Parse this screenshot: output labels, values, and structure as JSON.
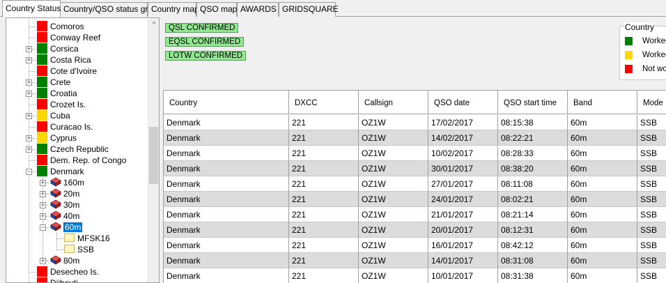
{
  "tabs": [
    {
      "label": "Country Status",
      "active": true
    },
    {
      "label": "Country/QSO status grid",
      "active": false
    },
    {
      "label": "Country map",
      "active": false
    },
    {
      "label": "QSO map",
      "active": false
    },
    {
      "label": "AWARDS",
      "active": false
    },
    {
      "label": "GRIDSQUARE",
      "active": false
    }
  ],
  "tree": {
    "items": [
      {
        "label": "Comoros",
        "status": "red",
        "expandable": false
      },
      {
        "label": "Conway Reef",
        "status": "red",
        "expandable": false
      },
      {
        "label": "Corsica",
        "status": "green",
        "expandable": true
      },
      {
        "label": "Costa Rica",
        "status": "green",
        "expandable": true
      },
      {
        "label": "Cote d'Ivoire",
        "status": "red",
        "expandable": false
      },
      {
        "label": "Crete",
        "status": "green",
        "expandable": true
      },
      {
        "label": "Croatia",
        "status": "green",
        "expandable": true
      },
      {
        "label": "Crozet Is.",
        "status": "red",
        "expandable": false
      },
      {
        "label": "Cuba",
        "status": "yellow",
        "expandable": true
      },
      {
        "label": "Curacao Is.",
        "status": "red",
        "expandable": false
      },
      {
        "label": "Cyprus",
        "status": "yellow",
        "expandable": true
      },
      {
        "label": "Czech Republic",
        "status": "green",
        "expandable": true
      },
      {
        "label": "Dem. Rep. of Congo",
        "status": "red",
        "expandable": false
      },
      {
        "label": "Denmark",
        "status": "green",
        "expanded": true
      },
      {
        "label": "160m",
        "band": true,
        "expandable": true
      },
      {
        "label": "20m",
        "band": true,
        "expandable": true
      },
      {
        "label": "30m",
        "band": true,
        "expandable": true
      },
      {
        "label": "40m",
        "band": true,
        "expandable": true
      },
      {
        "label": "60m",
        "band": true,
        "expanded": true,
        "selected": true
      },
      {
        "label": "MFSK16",
        "mode": true
      },
      {
        "label": "SSB",
        "mode": true
      },
      {
        "label": "80m",
        "band": true,
        "expandable": true
      },
      {
        "label": "Desecheo Is.",
        "status": "red",
        "expandable": false
      },
      {
        "label": "Djibouti",
        "status": "red",
        "expandable": false
      }
    ]
  },
  "confirmations": [
    "QSL CONFIRMED",
    "EQSL CONFIRMED",
    "LOTW CONFIRMED"
  ],
  "legend": {
    "title": "Country",
    "items": [
      {
        "label": "Worked",
        "color": "#008000"
      },
      {
        "label": "Worked",
        "color": "#ffd700"
      },
      {
        "label": "Not wo",
        "color": "#ff0000"
      }
    ]
  },
  "colors": {
    "red": "#ff0000",
    "green": "#008000",
    "yellow": "#ffd700",
    "selection": "#0078d7",
    "confirmed_bg": "#90e890"
  },
  "grid": {
    "columns": [
      "Country",
      "DXCC",
      "Callsign",
      "QSO date",
      "QSO start time",
      "Band",
      "Mode"
    ],
    "rows": [
      [
        "Denmark",
        "221",
        "OZ1W",
        "17/02/2017",
        "08:15:38",
        "60m",
        "SSB"
      ],
      [
        "Denmark",
        "221",
        "OZ1W",
        "14/02/2017",
        "08:22:21",
        "60m",
        "SSB"
      ],
      [
        "Denmark",
        "221",
        "OZ1W",
        "10/02/2017",
        "08:28:33",
        "60m",
        "SSB"
      ],
      [
        "Denmark",
        "221",
        "OZ1W",
        "30/01/2017",
        "08:38:20",
        "60m",
        "SSB"
      ],
      [
        "Denmark",
        "221",
        "OZ1W",
        "27/01/2017",
        "08:11:08",
        "60m",
        "SSB"
      ],
      [
        "Denmark",
        "221",
        "OZ1W",
        "24/01/2017",
        "08:02:21",
        "60m",
        "SSB"
      ],
      [
        "Denmark",
        "221",
        "OZ1W",
        "21/01/2017",
        "08:21:14",
        "60m",
        "SSB"
      ],
      [
        "Denmark",
        "221",
        "OZ1W",
        "20/01/2017",
        "08:12:31",
        "60m",
        "SSB"
      ],
      [
        "Denmark",
        "221",
        "OZ1W",
        "16/01/2017",
        "08:42:12",
        "60m",
        "SSB"
      ],
      [
        "Denmark",
        "221",
        "OZ1W",
        "14/01/2017",
        "08:31:08",
        "60m",
        "SSB"
      ],
      [
        "Denmark",
        "221",
        "OZ1W",
        "10/01/2017",
        "08:31:38",
        "60m",
        "SSB"
      ]
    ]
  }
}
